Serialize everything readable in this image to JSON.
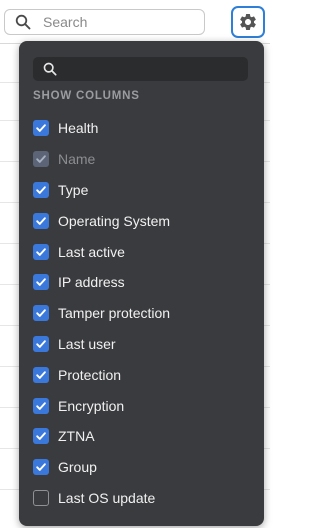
{
  "toolbar": {
    "search_placeholder": "Search",
    "search_value": ""
  },
  "popup": {
    "search_placeholder": "",
    "section_label": "SHOW COLUMNS",
    "columns": [
      {
        "label": "Health",
        "checked": true,
        "disabled": false
      },
      {
        "label": "Name",
        "checked": true,
        "disabled": true
      },
      {
        "label": "Type",
        "checked": true,
        "disabled": false
      },
      {
        "label": "Operating System",
        "checked": true,
        "disabled": false
      },
      {
        "label": "Last active",
        "checked": true,
        "disabled": false
      },
      {
        "label": "IP address",
        "checked": true,
        "disabled": false
      },
      {
        "label": "Tamper protection",
        "checked": true,
        "disabled": false
      },
      {
        "label": "Last user",
        "checked": true,
        "disabled": false
      },
      {
        "label": "Protection",
        "checked": true,
        "disabled": false
      },
      {
        "label": "Encryption",
        "checked": true,
        "disabled": false
      },
      {
        "label": "ZTNA",
        "checked": true,
        "disabled": false
      },
      {
        "label": "Group",
        "checked": true,
        "disabled": false
      },
      {
        "label": "Last OS update",
        "checked": false,
        "disabled": false
      }
    ]
  },
  "colors": {
    "accent": "#3a78db",
    "popup_bg": "#3a3b3e",
    "focus_ring": "#2f7fd6"
  },
  "icons": {
    "toolbar_search": "search-icon",
    "settings": "gear-icon",
    "popup_search": "search-icon",
    "checkbox_mark": "check-icon"
  }
}
